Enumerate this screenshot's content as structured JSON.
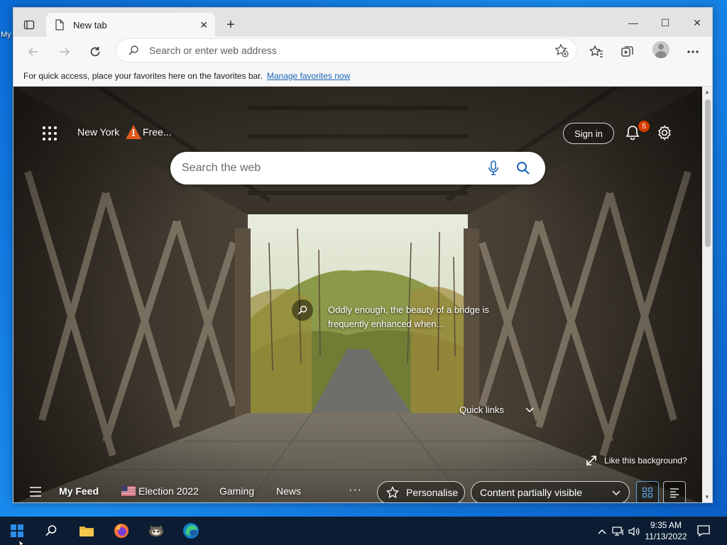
{
  "desktop": {
    "icon_label": "My"
  },
  "browser": {
    "tab": {
      "title": "New tab",
      "close": "✕"
    },
    "new_tab": "+",
    "window_controls": {
      "minimize": "—",
      "maximize": "☐",
      "close": "✕"
    },
    "address": {
      "placeholder": "Search or enter web address"
    },
    "favbar": {
      "message": "For quick access, place your favorites here on the favorites bar.",
      "link": "Manage favorites now"
    }
  },
  "ntp": {
    "location": "New York",
    "weather": "Free...",
    "sign_in": "Sign in",
    "notifications": "5",
    "search_placeholder": "Search the web",
    "caption": "Oddly enough, the beauty of a bridge is frequently enhanced when...",
    "quick_links": "Quick links",
    "like_background": "Like this background?",
    "feed": {
      "my_feed": "My Feed",
      "election": "Election 2022",
      "gaming": "Gaming",
      "news": "News",
      "more": "···",
      "personalise": "Personalise",
      "content_visibility": "Content partially visible"
    }
  },
  "taskbar": {
    "time": "9:35 AM",
    "date": "11/13/2022",
    "icons": [
      "windows-start-icon",
      "search-icon",
      "file-explorer-icon",
      "firefox-icon",
      "app-icon",
      "edge-icon"
    ]
  },
  "colors": {
    "accent": "#1d65b8",
    "badge": "#d83b01",
    "taskbar": "#0c1d33"
  }
}
